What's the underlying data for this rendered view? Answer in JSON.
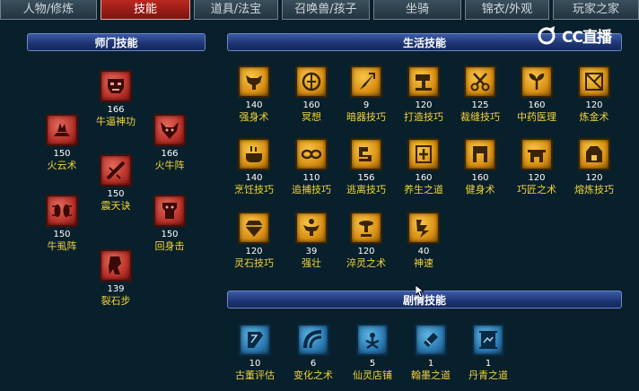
{
  "tabs": [
    "人物/修炼",
    "技能",
    "道具/法宝",
    "召唤兽/孩子",
    "坐骑",
    "锦衣/外观",
    "玩家之家"
  ],
  "active_tab": "技能",
  "logo": {
    "text": "CC直播"
  },
  "sections": {
    "shimen": {
      "title": "师门技能"
    },
    "life": {
      "title": "生活技能"
    },
    "plot": {
      "title": "剧情技能"
    }
  },
  "shimen_skills": [
    {
      "level": "166",
      "name": "牛逼神功",
      "icon": "demon-mask-icon"
    },
    {
      "level": "150",
      "name": "火云术",
      "icon": "flame-wave-icon"
    },
    {
      "level": "166",
      "name": "火牛阵",
      "icon": "bull-head-icon"
    },
    {
      "level": "150",
      "name": "震天诀",
      "icon": "slash-icon"
    },
    {
      "level": "150",
      "name": "牛虱阵",
      "icon": "beetle-icon"
    },
    {
      "level": "150",
      "name": "回身击",
      "icon": "turn-strike-icon"
    },
    {
      "level": "139",
      "name": "裂石步",
      "icon": "stone-step-icon"
    }
  ],
  "life_skills": [
    {
      "level": "140",
      "name": "强身术",
      "icon": "muscle-icon"
    },
    {
      "level": "160",
      "name": "冥想",
      "icon": "meditation-icon"
    },
    {
      "level": "9",
      "name": "暗器技巧",
      "icon": "dart-icon"
    },
    {
      "level": "120",
      "name": "打造技巧",
      "icon": "hammer-icon"
    },
    {
      "level": "125",
      "name": "裁缝技巧",
      "icon": "scissors-icon"
    },
    {
      "level": "160",
      "name": "中药医理",
      "icon": "herb-icon"
    },
    {
      "level": "120",
      "name": "炼金术",
      "icon": "alchemy-icon"
    },
    {
      "level": "140",
      "name": "烹饪技巧",
      "icon": "cooking-pot-icon"
    },
    {
      "level": "110",
      "name": "追捕技巧",
      "icon": "chain-icon"
    },
    {
      "level": "156",
      "name": "逃离技巧",
      "icon": "escape-icon"
    },
    {
      "level": "160",
      "name": "养生之道",
      "icon": "health-icon"
    },
    {
      "level": "160",
      "name": "健身术",
      "icon": "fitness-icon"
    },
    {
      "level": "120",
      "name": "巧匠之术",
      "icon": "craftsman-icon"
    },
    {
      "level": "120",
      "name": "熔炼技巧",
      "icon": "furnace-icon"
    },
    {
      "level": "120",
      "name": "灵石技巧",
      "icon": "gem-icon"
    },
    {
      "level": "39",
      "name": "强壮",
      "icon": "strong-icon"
    },
    {
      "level": "120",
      "name": "淬灵之术",
      "icon": "tempering-icon"
    },
    {
      "level": "40",
      "name": "神速",
      "icon": "speed-icon"
    }
  ],
  "plot_skills": [
    {
      "level": "10",
      "name": "古董评估",
      "icon": "antique-icon"
    },
    {
      "level": "6",
      "name": "变化之术",
      "icon": "transform-icon"
    },
    {
      "level": "5",
      "name": "仙灵店铺",
      "icon": "shop-icon"
    },
    {
      "level": "1",
      "name": "翰墨之道",
      "icon": "ink-brush-icon"
    },
    {
      "level": "1",
      "name": "丹青之道",
      "icon": "painting-scroll-icon"
    }
  ],
  "colors": {
    "red_icon": "#b8322a",
    "gold_icon": "#d98f14",
    "blue_icon": "#2a78b0",
    "name_text": "#f2d23c",
    "active_tab": "#b8291f"
  }
}
